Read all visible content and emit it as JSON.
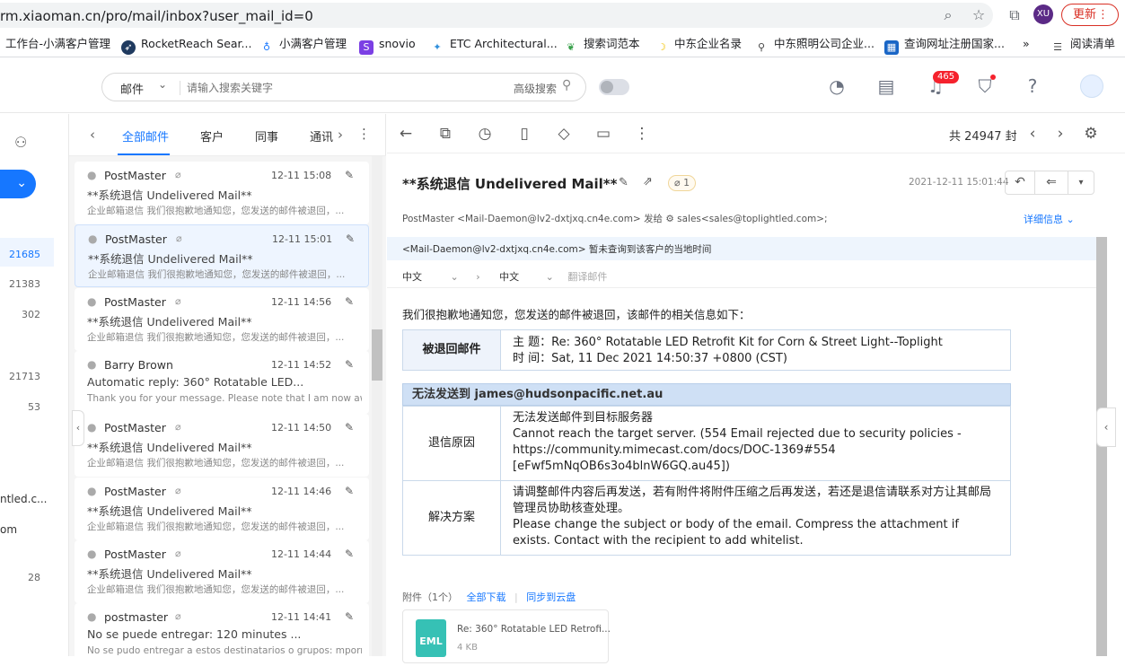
{
  "browser": {
    "url": "rm.xiaoman.cn/pro/mail/inbox?user_mail_id=0",
    "avatar_initials": "XU",
    "update_label": "更新",
    "bookmarks": [
      {
        "label": "工作台-小满客户管理",
        "icon": "none",
        "color": "#ffffff"
      },
      {
        "label": "RocketReach Sear...",
        "icon": "rocket-icon",
        "color": "#1f3a5f"
      },
      {
        "label": "小满客户管理",
        "icon": "pin-icon",
        "color": "#1677ff"
      },
      {
        "label": "snovio",
        "icon": "s-icon",
        "color": "#7b3fe4"
      },
      {
        "label": "ETC Architectural...",
        "icon": "etc-icon",
        "color": "#2f8fdc"
      },
      {
        "label": "搜索词范本",
        "icon": "leaf-icon",
        "color": "#3aa14c"
      },
      {
        "label": "中东企业名录",
        "icon": "moon-icon",
        "color": "#f2c200"
      },
      {
        "label": "中东照明公司企业...",
        "icon": "search-icon",
        "color": "#444444"
      },
      {
        "label": "查询网址注册国家...",
        "icon": "site-icon",
        "color": "#1a66c6"
      },
      {
        "label": "»",
        "icon": "none",
        "color": "#ffffff"
      },
      {
        "label": "阅读清单",
        "icon": "reading-list-icon",
        "color": "#444444"
      }
    ]
  },
  "header": {
    "search_type": "邮件",
    "search_placeholder": "请输入搜索关键字",
    "advanced_search": "高级搜索",
    "notification_count": "465"
  },
  "leftcol": {
    "counts": [
      "21685",
      "21383",
      "302",
      "21713",
      "53",
      "28"
    ],
    "partial_texts": [
      "ntled.c...",
      "om"
    ]
  },
  "list": {
    "tabs": [
      "全部邮件",
      "客户",
      "同事",
      "通讯"
    ],
    "mails": [
      {
        "from": "PostMaster",
        "time": "12-11 15:08",
        "subject": "**系统退信 Undelivered Mail**",
        "preview": "企业邮箱退信 我们很抱歉地通知您，您发送的邮件被退回，...",
        "clip": true
      },
      {
        "from": "PostMaster",
        "time": "12-11 15:01",
        "subject": "**系统退信 Undelivered Mail**",
        "preview": "企业邮箱退信 我们很抱歉地通知您，您发送的邮件被退回，...",
        "clip": true
      },
      {
        "from": "PostMaster",
        "time": "12-11 14:56",
        "subject": "**系统退信 Undelivered Mail**",
        "preview": "企业邮箱退信 我们很抱歉地通知您，您发送的邮件被退回，...",
        "clip": true
      },
      {
        "from": "Barry Brown",
        "time": "12-11 14:52",
        "subject": "Automatic reply: 360° Rotatable LED...",
        "preview": "Thank you for your message. Please note that I am now away ...",
        "clip": false
      },
      {
        "from": "PostMaster",
        "time": "12-11 14:50",
        "subject": "**系统退信 Undelivered Mail**",
        "preview": "企业邮箱退信 我们很抱歉地通知您，您发送的邮件被退回，...",
        "clip": true
      },
      {
        "from": "PostMaster",
        "time": "12-11 14:46",
        "subject": "**系统退信 Undelivered Mail**",
        "preview": "企业邮箱退信 我们很抱歉地通知您，您发送的邮件被退回，...",
        "clip": true
      },
      {
        "from": "PostMaster",
        "time": "12-11 14:44",
        "subject": "**系统退信 Undelivered Mail**",
        "preview": "企业邮箱退信 我们很抱歉地通知您，您发送的邮件被退回，...",
        "clip": true
      },
      {
        "from": "postmaster",
        "time": "12-11 14:41",
        "subject": "No se puede entregar: 120 minutes ...",
        "preview": "No se pudo entregar a estos destinatarios o grupos: mporro...",
        "clip": true
      }
    ]
  },
  "reader": {
    "total": "共 24947 封",
    "subject": "**系统退信 Undelivered Mail**",
    "attach_count": "1",
    "date": "2021-12-11 15:01:44",
    "meta": "PostMaster <Mail-Daemon@lv2-dxtjxq.cn4e.com> 发给 ⚙ sales<sales@toplightled.com>;",
    "detail_link": "详细信息",
    "notice": "<Mail-Daemon@lv2-dxtjxq.cn4e.com> 暂未查询到该客户的当地时间",
    "translate_from": "中文",
    "translate_to": "中文",
    "translate_btn": "翻译邮件",
    "intro": "我们很抱歉地通知您，您发送的邮件被退回，该邮件的相关信息如下：",
    "bounced_label": "被退回邮件",
    "bounced_subject": "主 题：Re: 360° Rotatable LED Retrofit Kit for Corn & Street Light--Toplight",
    "bounced_time": "时 间：Sat, 11 Dec 2021 14:50:37 +0800 (CST)",
    "fail_header": "无法发送到 james@hudsonpacific.net.au",
    "reason_label": "退信原因",
    "reason_text": "无法发送邮件到目标服务器\nCannot reach the target server. (554 Email rejected due to security policies - https://community.mimecast.com/docs/DOC-1369#554 [eFwf5mNqOB6s3o4blnW6GQ.au45])",
    "solution_label": "解决方案",
    "solution_text": "请调整邮件内容后再发送，若有附件将附件压缩之后再发送，若还是退信请联系对方让其邮局管理员协助核查处理。\nPlease change the subject or body of the email. Compress the attachment if exists. Contact with the recipient to add whitelist.",
    "attach_label": "附件（1个）",
    "download_all": "全部下载",
    "sync_cloud": "同步到云盘",
    "attach_name": "Re: 360° Rotatable LED Retrofi...",
    "attach_type": "EML",
    "attach_size": "4 KB"
  }
}
